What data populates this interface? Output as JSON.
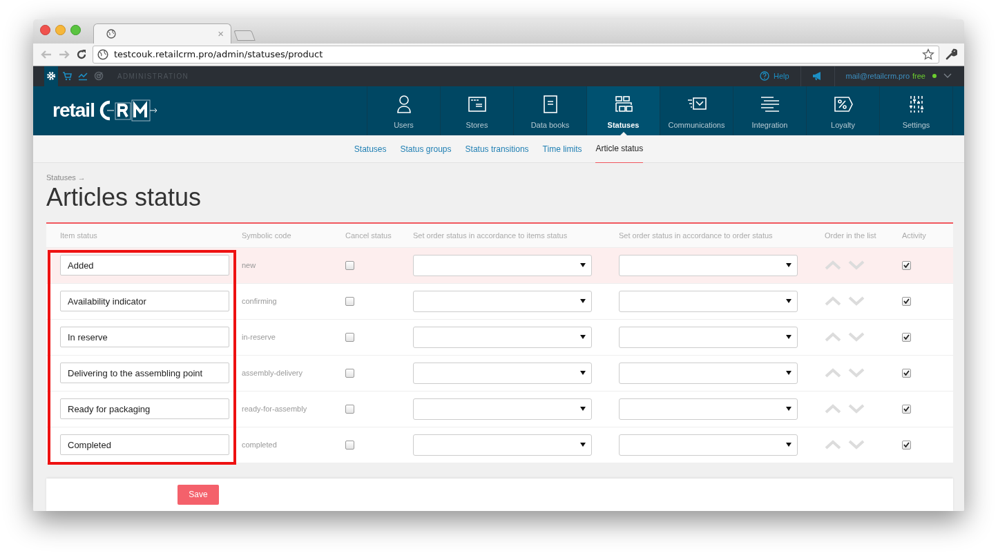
{
  "browser": {
    "tab_close": "×",
    "url": "testcouk.retailcrm.pro/admin/statuses/product"
  },
  "admin_bar": {
    "tools": [
      {
        "selected": true
      },
      {
        "selected": false
      },
      {
        "selected": false
      },
      {
        "selected": false
      }
    ],
    "label": "ADMINISTRATION",
    "help": "Help",
    "email": "mail@retailcrm.pro",
    "plan": "free"
  },
  "logo_text": "retail",
  "nav": [
    {
      "label": "Users",
      "selected": false
    },
    {
      "label": "Stores",
      "selected": false
    },
    {
      "label": "Data books",
      "selected": false
    },
    {
      "label": "Statuses",
      "selected": true
    },
    {
      "label": "Communications",
      "selected": false
    },
    {
      "label": "Integration",
      "selected": false
    },
    {
      "label": "Loyalty",
      "selected": false
    },
    {
      "label": "Settings",
      "selected": false
    }
  ],
  "subnav": [
    {
      "label": "Statuses",
      "selected": false
    },
    {
      "label": "Status groups",
      "selected": false
    },
    {
      "label": "Status transitions",
      "selected": false
    },
    {
      "label": "Time limits",
      "selected": false
    },
    {
      "label": "Article status",
      "selected": true
    }
  ],
  "breadcrumb": "Statuses →",
  "title": "Articles status",
  "table": {
    "columns": [
      "Item status",
      "Symbolic code",
      "Cancel status",
      "Set order status in accordance to items status",
      "Set order status in accordance to order status",
      "Order in the list",
      "Activity"
    ],
    "rows": [
      {
        "name": "Added",
        "code": "new",
        "cancel": false,
        "active": true,
        "highlighted": true
      },
      {
        "name": "Availability indicator",
        "code": "confirming",
        "cancel": false,
        "active": true,
        "highlighted": false
      },
      {
        "name": "In reserve",
        "code": "in-reserve",
        "cancel": false,
        "active": true,
        "highlighted": false
      },
      {
        "name": "Delivering to the assembling point",
        "code": "assembly-delivery",
        "cancel": false,
        "active": true,
        "highlighted": false
      },
      {
        "name": "Ready for packaging",
        "code": "ready-for-assembly",
        "cancel": false,
        "active": true,
        "highlighted": false
      },
      {
        "name": "Completed",
        "code": "completed",
        "cancel": false,
        "active": true,
        "highlighted": false
      }
    ]
  },
  "save": "Save"
}
